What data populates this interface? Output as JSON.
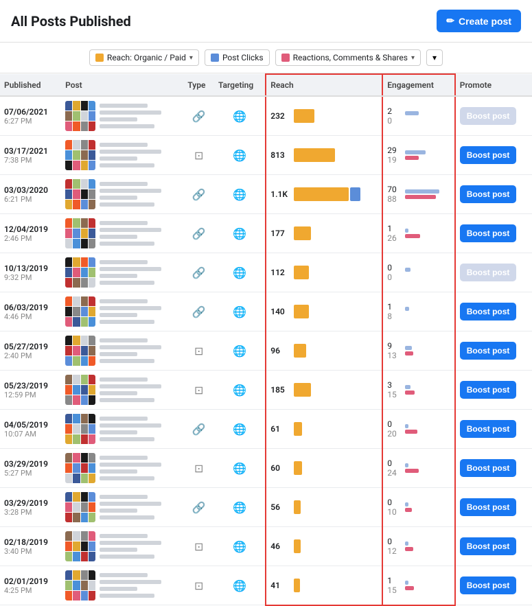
{
  "header": {
    "title": "All Posts Published",
    "create_button": "Create post"
  },
  "filters": {
    "reach_label": "Reach: Organic / Paid",
    "post_clicks_label": "Post Clicks",
    "reactions_label": "Reactions, Comments & Shares"
  },
  "table": {
    "columns": [
      "Published",
      "Post",
      "Type",
      "Targeting",
      "Reach",
      "Engagement",
      "Promote"
    ],
    "rows": [
      {
        "date": "07/06/2021",
        "time": "6:27 PM",
        "type": "link",
        "targeting": "public",
        "reach": "232",
        "reach_bar_orange": 30,
        "reach_bar_blue": 0,
        "eng_top": "2",
        "eng_bot": "0",
        "eng_bar_blue": 20,
        "eng_bar_pink": 0,
        "boost_disabled": true,
        "thumb_color": "#f05a28"
      },
      {
        "date": "03/17/2021",
        "time": "7:38 PM",
        "type": "album",
        "targeting": "public",
        "reach": "813",
        "reach_bar_orange": 60,
        "reach_bar_blue": 0,
        "eng_top": "29",
        "eng_bot": "19",
        "eng_bar_blue": 30,
        "eng_bar_pink": 20,
        "boost_disabled": false,
        "thumb_color": "#e0a030"
      },
      {
        "date": "03/03/2020",
        "time": "6:21 PM",
        "type": "link",
        "targeting": "public",
        "reach": "1.1K",
        "reach_bar_orange": 80,
        "reach_bar_blue": 15,
        "eng_top": "70",
        "eng_bot": "88",
        "eng_bar_blue": 50,
        "eng_bar_pink": 45,
        "boost_disabled": false,
        "thumb_color": "#1a1a1a"
      },
      {
        "date": "12/04/2019",
        "time": "2:46 PM",
        "type": "link",
        "targeting": "public",
        "reach": "177",
        "reach_bar_orange": 25,
        "reach_bar_blue": 0,
        "eng_top": "1",
        "eng_bot": "26",
        "eng_bar_blue": 5,
        "eng_bar_pink": 22,
        "boost_disabled": false,
        "thumb_color": "#333"
      },
      {
        "date": "10/13/2019",
        "time": "9:32 PM",
        "type": "link",
        "targeting": "public",
        "reach": "112",
        "reach_bar_orange": 22,
        "reach_bar_blue": 0,
        "eng_top": "0",
        "eng_bot": "0",
        "eng_bar_blue": 8,
        "eng_bar_pink": 0,
        "boost_disabled": true,
        "thumb_color": "#f07030"
      },
      {
        "date": "06/03/2019",
        "time": "4:46 PM",
        "type": "link",
        "targeting": "public",
        "reach": "140",
        "reach_bar_orange": 22,
        "reach_bar_blue": 0,
        "eng_top": "1",
        "eng_bot": "8",
        "eng_bar_blue": 6,
        "eng_bar_pink": 0,
        "boost_disabled": false,
        "thumb_color": "#e07030"
      },
      {
        "date": "05/27/2019",
        "time": "2:40 PM",
        "type": "album",
        "targeting": "public",
        "reach": "96",
        "reach_bar_orange": 18,
        "reach_bar_blue": 0,
        "eng_top": "9",
        "eng_bot": "13",
        "eng_bar_blue": 10,
        "eng_bar_pink": 12,
        "boost_disabled": false,
        "thumb_color": "#8b6a50"
      },
      {
        "date": "05/23/2019",
        "time": "12:59 PM",
        "type": "album",
        "targeting": "public",
        "reach": "185",
        "reach_bar_orange": 25,
        "reach_bar_blue": 0,
        "eng_top": "3",
        "eng_bot": "15",
        "eng_bar_blue": 8,
        "eng_bar_pink": 14,
        "boost_disabled": false,
        "thumb_color": "#a09070"
      },
      {
        "date": "04/05/2019",
        "time": "10:07 AM",
        "type": "link",
        "targeting": "public",
        "reach": "61",
        "reach_bar_orange": 12,
        "reach_bar_blue": 0,
        "eng_top": "0",
        "eng_bot": "20",
        "eng_bar_blue": 5,
        "eng_bar_pink": 18,
        "boost_disabled": false,
        "thumb_color": "#0a0a0a"
      },
      {
        "date": "03/29/2019",
        "time": "5:27 PM",
        "type": "album",
        "targeting": "public",
        "reach": "60",
        "reach_bar_orange": 12,
        "reach_bar_blue": 0,
        "eng_top": "0",
        "eng_bot": "24",
        "eng_bar_blue": 5,
        "eng_bar_pink": 20,
        "boost_disabled": false,
        "thumb_color": "#888"
      },
      {
        "date": "03/29/2019",
        "time": "3:28 PM",
        "type": "link",
        "targeting": "public",
        "reach": "56",
        "reach_bar_orange": 10,
        "reach_bar_blue": 0,
        "eng_top": "0",
        "eng_bot": "10",
        "eng_bar_blue": 5,
        "eng_bar_pink": 10,
        "boost_disabled": false,
        "thumb_color": "#c03030"
      },
      {
        "date": "02/18/2019",
        "time": "3:40 PM",
        "type": "album",
        "targeting": "public",
        "reach": "46",
        "reach_bar_orange": 10,
        "reach_bar_blue": 0,
        "eng_top": "0",
        "eng_bot": "12",
        "eng_bar_blue": 5,
        "eng_bar_pink": 12,
        "boost_disabled": false,
        "thumb_color": "#ddd"
      },
      {
        "date": "02/01/2019",
        "time": "4:25 PM",
        "type": "album",
        "targeting": "public",
        "reach": "41",
        "reach_bar_orange": 9,
        "reach_bar_blue": 0,
        "eng_top": "1",
        "eng_bot": "15",
        "eng_bar_blue": 5,
        "eng_bar_pink": 13,
        "boost_disabled": false,
        "thumb_color": "#e0a030"
      }
    ],
    "boost_label": "Boost post"
  }
}
